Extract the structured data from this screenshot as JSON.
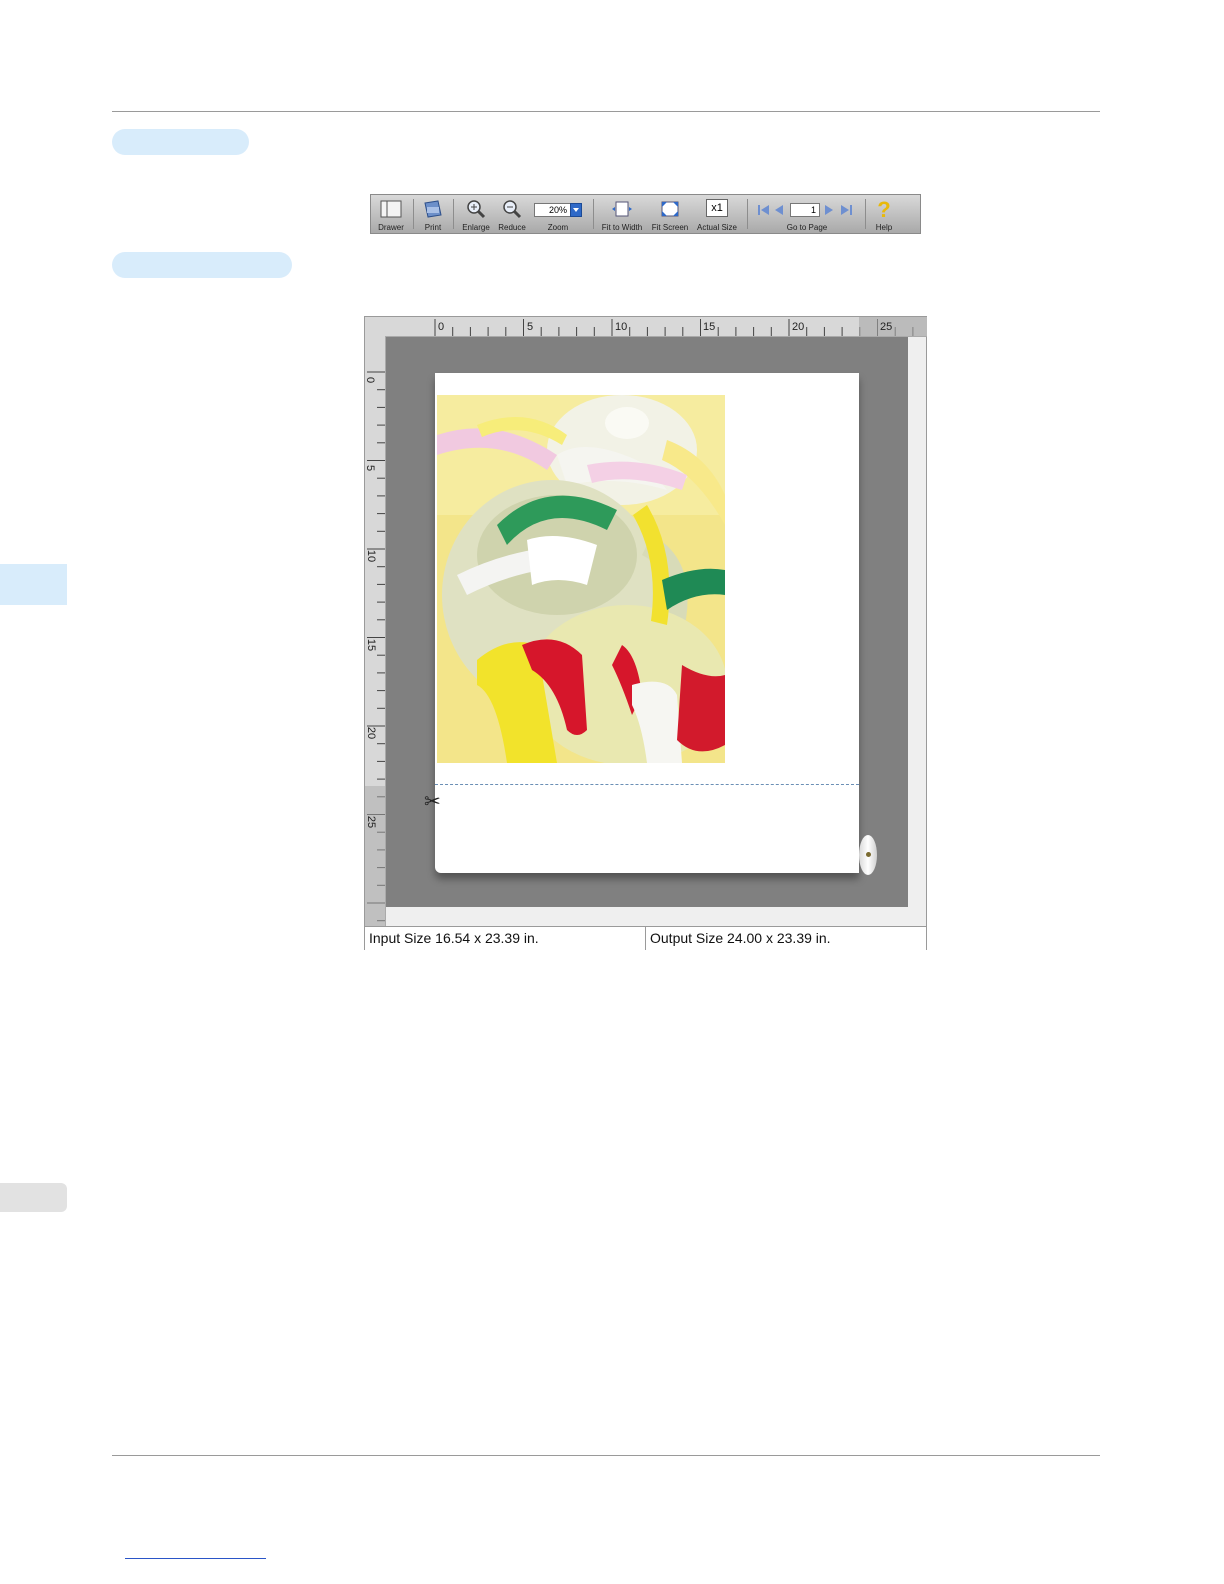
{
  "toolbar": {
    "drawer": "Drawer",
    "print": "Print",
    "enlarge": "Enlarge",
    "reduce": "Reduce",
    "zoom_value": "20%",
    "zoom": "Zoom",
    "fit_to_width": "Fit to Width",
    "fit_screen": "Fit Screen",
    "actual_size_icon": "x1",
    "actual_size": "Actual Size",
    "page_value": "1",
    "go_to_page": "Go to Page",
    "help": "Help"
  },
  "ruler": {
    "top_labels": [
      "0",
      "5",
      "10",
      "15",
      "20",
      "25"
    ],
    "left_labels": [
      "0",
      "5",
      "10",
      "15",
      "20",
      "25"
    ]
  },
  "status": {
    "input_size": "Input Size 16.54 x 23.39 in.",
    "output_size": "Output Size 24.00 x 23.39 in."
  },
  "colors": {
    "accent_light_blue": "#d8ecfb",
    "canvas_gray": "#808080"
  }
}
